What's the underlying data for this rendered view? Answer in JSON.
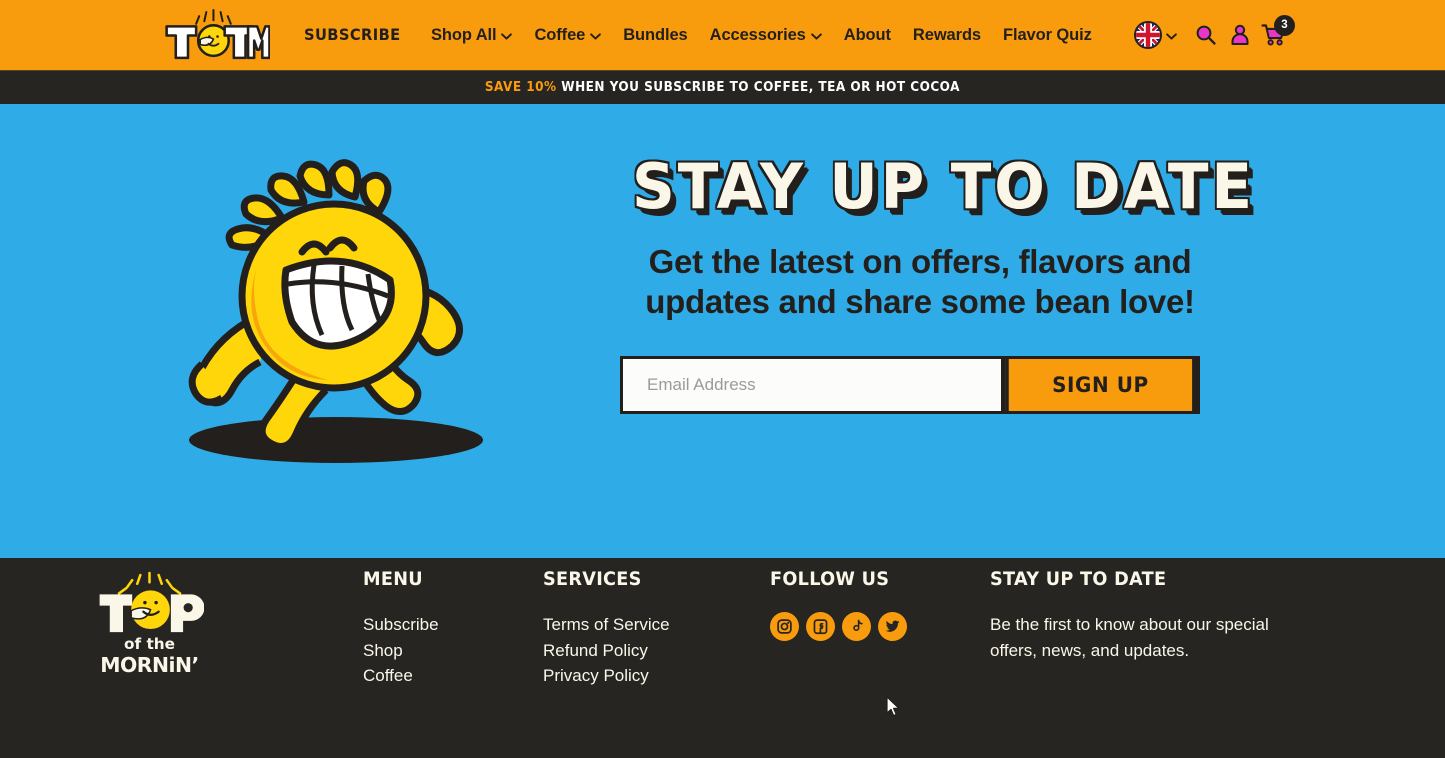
{
  "colors": {
    "brand_orange": "#F89C0E",
    "dark": "#262522",
    "hero_blue": "#2FACE8",
    "cream": "#FAF6E8",
    "magenta": "#E638C4",
    "sun_yellow": "#FFD60A"
  },
  "header": {
    "logo_alt": "Top of the Mornin' TOTM logo",
    "nav": [
      {
        "label": "Subscribe",
        "has_caret": false,
        "style": "display"
      },
      {
        "label": "Shop All",
        "has_caret": true,
        "style": "regular"
      },
      {
        "label": "Coffee",
        "has_caret": true,
        "style": "regular"
      },
      {
        "label": "Bundles",
        "has_caret": false,
        "style": "regular"
      },
      {
        "label": "Accessories",
        "has_caret": true,
        "style": "regular"
      },
      {
        "label": "About",
        "has_caret": false,
        "style": "regular"
      },
      {
        "label": "Rewards",
        "has_caret": false,
        "style": "regular"
      },
      {
        "label": "Flavor Quiz",
        "has_caret": false,
        "style": "regular"
      }
    ],
    "locale": {
      "flag": "united-kingdom-flag",
      "has_caret": true
    },
    "actions": {
      "search": "search-icon",
      "account": "account-icon",
      "cart": "cart-icon",
      "cart_count": "3"
    }
  },
  "announcement": {
    "highlight": "SAVE 10%",
    "rest": "WHEN YOU SUBSCRIBE TO COFFEE, TEA OR HOT COCOA"
  },
  "hero": {
    "mascot_alt": "walking smiling sun mascot",
    "title": "STAY UP TO DATE",
    "subtitle": "Get the latest on offers, flavors and updates and share some bean love!",
    "form": {
      "email_placeholder": "Email Address",
      "email_value": "",
      "submit_label": "Sign Up"
    }
  },
  "footer": {
    "logo_alt": "Top of the Mornin' logo",
    "columns": [
      {
        "title": "MENU",
        "items": [
          "Subscribe",
          "Shop",
          "Coffee"
        ]
      },
      {
        "title": "SERVICES",
        "items": [
          "Terms of Service",
          "Refund Policy",
          "Privacy Policy"
        ]
      }
    ],
    "follow": {
      "title": "FOLLOW US",
      "socials": [
        {
          "name": "instagram-icon",
          "label": "Instagram"
        },
        {
          "name": "facebook-icon",
          "label": "Facebook"
        },
        {
          "name": "tiktok-icon",
          "label": "TikTok"
        },
        {
          "name": "twitter-icon",
          "label": "Twitter"
        }
      ]
    },
    "stay": {
      "title": "STAY UP TO DATE",
      "text": "Be the first to know about our special offers, news, and updates."
    }
  }
}
